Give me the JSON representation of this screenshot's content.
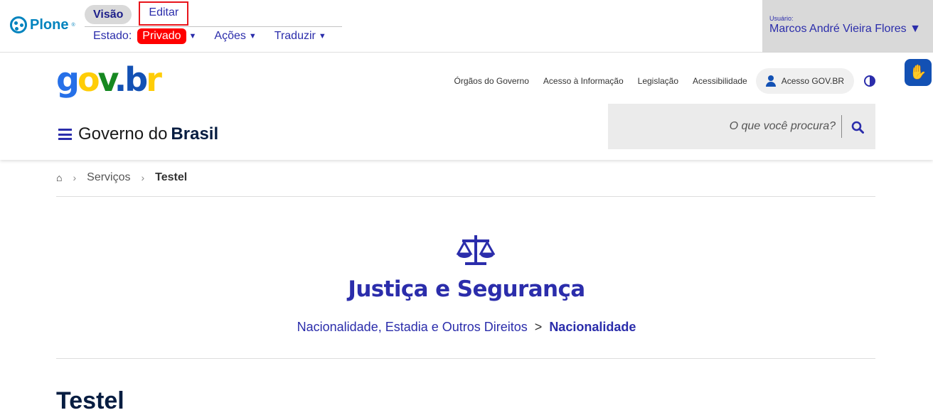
{
  "plone": {
    "logo_text": "Plone",
    "tabs": {
      "view": "Visão",
      "edit": "Editar"
    },
    "menu": {
      "state_label": "Estado:",
      "state_value": "Privado",
      "actions": "Ações",
      "translate": "Traduzir"
    },
    "user": {
      "label": "Usuário:",
      "name": "Marcos André Vieira Flores ▼"
    }
  },
  "header": {
    "logo": {
      "g": "g",
      "o": "o",
      "v": "v",
      "dot": ".",
      "b": "b",
      "r": "r"
    },
    "links": [
      "Órgãos do Governo",
      "Acesso à Informação",
      "Legislação",
      "Acessibilidade"
    ],
    "login": "Acesso GOV.BR",
    "site_title_prefix": "Governo do",
    "site_title_bold": "Brasil",
    "search_placeholder": "O que você procura?"
  },
  "breadcrumb": {
    "home": "⌂",
    "items": [
      "Serviços",
      "Testel"
    ]
  },
  "category": {
    "title": "Justiça e Segurança",
    "crumb_parent": "Nacionalidade, Estadia e Outros Direitos",
    "crumb_sep": ">",
    "crumb_current": "Nacionalidade"
  },
  "page": {
    "title": "Testel"
  },
  "colors": {
    "primary": "#2b2dab",
    "state_red": "#ff0000",
    "edit_border": "#e8141b",
    "user_bg": "#d9d9d9"
  }
}
